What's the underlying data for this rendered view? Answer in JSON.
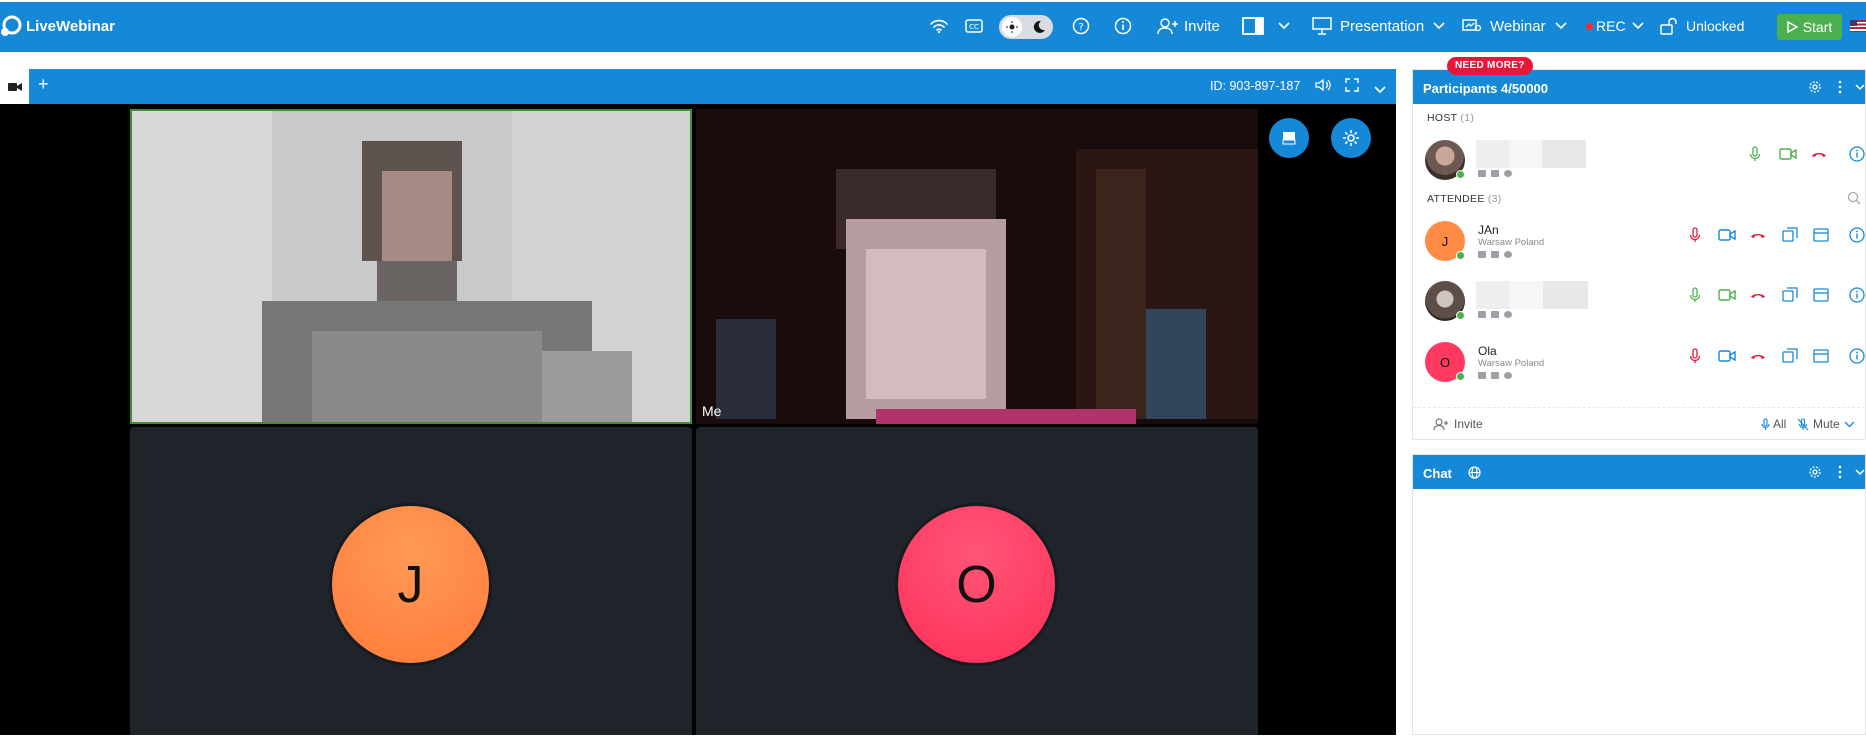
{
  "app": {
    "name": "LiveWebinar"
  },
  "toolbar": {
    "invite_label": "Invite",
    "presentation_label": "Presentation",
    "webinar_label": "Webinar",
    "rec_label": "REC",
    "lock_label": "Unlocked",
    "start_label": "Start"
  },
  "stage": {
    "id_label": "ID: 903-897-187",
    "me_label": "Me",
    "tiles": [
      {
        "initial": "J",
        "color": "#ff8b47"
      },
      {
        "initial": "O",
        "color": "#ff3a61"
      }
    ]
  },
  "participants": {
    "title": "Participants 4/50000",
    "badge": "NEED MORE?",
    "host_label": "HOST",
    "host_count": "(1)",
    "attendee_label": "ATTENDEE",
    "attendee_count": "(3)",
    "rows": [
      {
        "name": "JAn",
        "location": "Warsaw Poland",
        "initial": "J",
        "color": "#ff8b47",
        "mic": "muted"
      },
      {
        "name": "Ola",
        "location": "Warsaw Poland",
        "initial": "O",
        "color": "#ff3a61",
        "mic": "muted"
      }
    ],
    "invite_label": "Invite",
    "all_label": "All",
    "mute_label": "Mute"
  },
  "chat": {
    "title": "Chat"
  },
  "colors": {
    "brand": "#1589d8",
    "green": "#4cb050",
    "red": "#e8173a"
  }
}
